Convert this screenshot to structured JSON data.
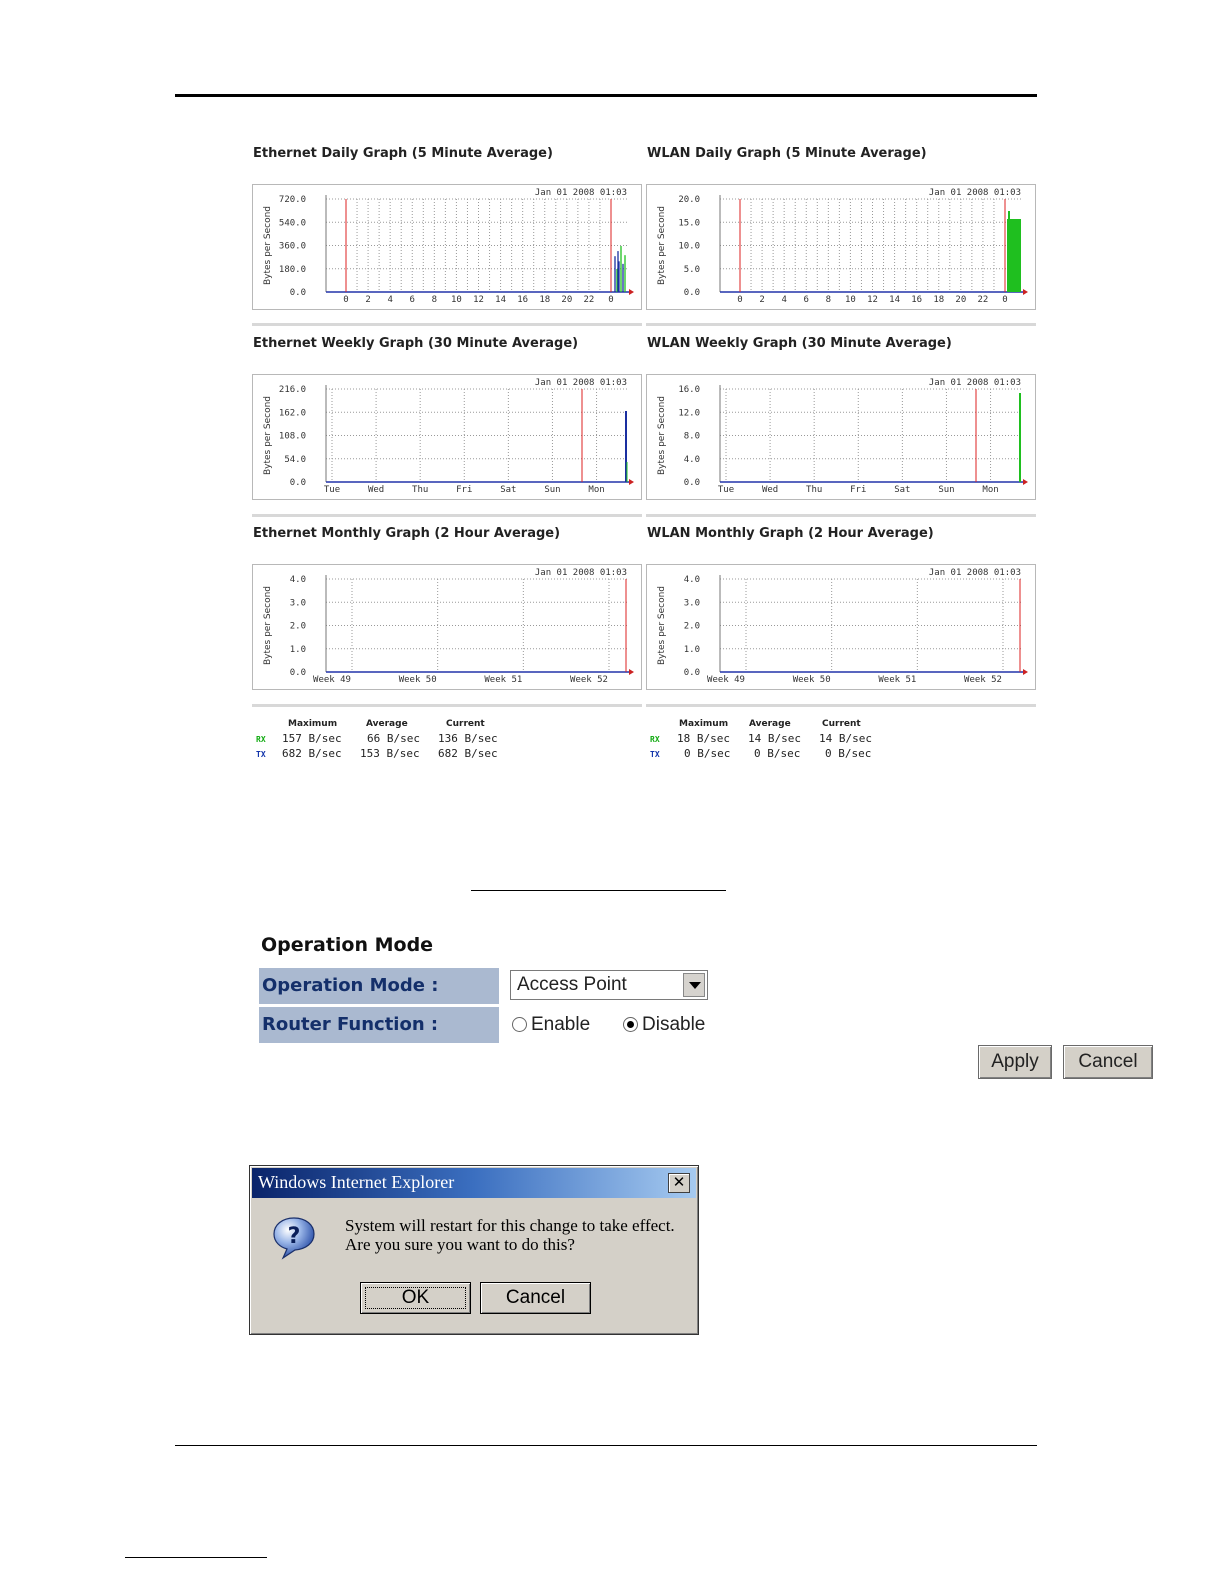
{
  "graphs": [
    {
      "id": "eth-daily",
      "title": "Ethernet Daily Graph (5 Minute Average)",
      "timestamp": "Jan 01 2008 01:03",
      "ylabel": "Bytes per Second",
      "yticks": [
        "720.0",
        "540.0",
        "360.0",
        "180.0",
        "0.0"
      ],
      "xticks": [
        "0",
        "2",
        "4",
        "6",
        "8",
        "10",
        "12",
        "14",
        "16",
        "18",
        "20",
        "22",
        "0"
      ],
      "traffic_color": "#1a2fa0"
    },
    {
      "id": "wlan-daily",
      "title": "WLAN Daily Graph (5 Minute Average)",
      "timestamp": "Jan 01 2008 01:03",
      "ylabel": "Bytes per Second",
      "yticks": [
        "20.0",
        "15.0",
        "10.0",
        "5.0",
        "0.0"
      ],
      "xticks": [
        "0",
        "2",
        "4",
        "6",
        "8",
        "10",
        "12",
        "14",
        "16",
        "18",
        "20",
        "22",
        "0"
      ],
      "traffic_color": "#1fbf1f"
    },
    {
      "id": "eth-weekly",
      "title": "Ethernet Weekly Graph (30 Minute Average)",
      "timestamp": "Jan 01 2008 01:03",
      "ylabel": "Bytes per Second",
      "yticks": [
        "216.0",
        "162.0",
        "108.0",
        "54.0",
        "0.0"
      ],
      "xticks": [
        "Tue",
        "Wed",
        "Thu",
        "Fri",
        "Sat",
        "Sun",
        "Mon"
      ],
      "traffic_color": "#1a2fa0"
    },
    {
      "id": "wlan-weekly",
      "title": "WLAN Weekly Graph (30 Minute Average)",
      "timestamp": "Jan 01 2008 01:03",
      "ylabel": "Bytes per Second",
      "yticks": [
        "16.0",
        "12.0",
        "8.0",
        "4.0",
        "0.0"
      ],
      "xticks": [
        "Tue",
        "Wed",
        "Thu",
        "Fri",
        "Sat",
        "Sun",
        "Mon"
      ],
      "traffic_color": "#1fbf1f"
    },
    {
      "id": "eth-monthly",
      "title": "Ethernet Monthly Graph (2 Hour Average)",
      "timestamp": "Jan 01 2008 01:03",
      "ylabel": "Bytes per Second",
      "yticks": [
        "4.0",
        "3.0",
        "2.0",
        "1.0",
        "0.0"
      ],
      "xticks": [
        "Week 49",
        "Week 50",
        "Week 51",
        "Week 52"
      ],
      "traffic_color": "#1a2fa0"
    },
    {
      "id": "wlan-monthly",
      "title": "WLAN Monthly Graph (2 Hour Average)",
      "timestamp": "Jan 01 2008 01:03",
      "ylabel": "Bytes per Second",
      "yticks": [
        "4.0",
        "3.0",
        "2.0",
        "1.0",
        "0.0"
      ],
      "xticks": [
        "Week 49",
        "Week 50",
        "Week 51",
        "Week 52"
      ],
      "traffic_color": "#1fbf1f"
    }
  ],
  "legend_headers": {
    "max": "Maximum",
    "avg": "Average",
    "cur": "Current"
  },
  "stats": {
    "ethernet": {
      "rx_label": "RX",
      "rx_max": "157 B/sec",
      "rx_avg": "66 B/sec",
      "rx_cur": "136 B/sec",
      "tx_label": "TX",
      "tx_max": "682 B/sec",
      "tx_avg": "153 B/sec",
      "tx_cur": "682 B/sec"
    },
    "wlan": {
      "rx_label": "RX",
      "rx_max": "18 B/sec",
      "rx_avg": "14 B/sec",
      "rx_cur": "14 B/sec",
      "tx_label": "TX",
      "tx_max": "0 B/sec",
      "tx_avg": "0 B/sec",
      "tx_cur": "0 B/sec"
    }
  },
  "operation": {
    "title": "Operation Mode",
    "mode_label": "Operation Mode :",
    "mode_value": "Access Point",
    "router_label": "Router Function :",
    "enable_label": "Enable",
    "disable_label": "Disable",
    "router_selected": "Disable",
    "apply_label": "Apply",
    "cancel_label": "Cancel"
  },
  "dialog": {
    "title": "Windows Internet Explorer",
    "close_glyph": "✕",
    "line1": "System will restart for this change to take effect.",
    "line2": "Are you sure you want to do this?",
    "ok_label": "OK",
    "cancel_label": "Cancel"
  }
}
